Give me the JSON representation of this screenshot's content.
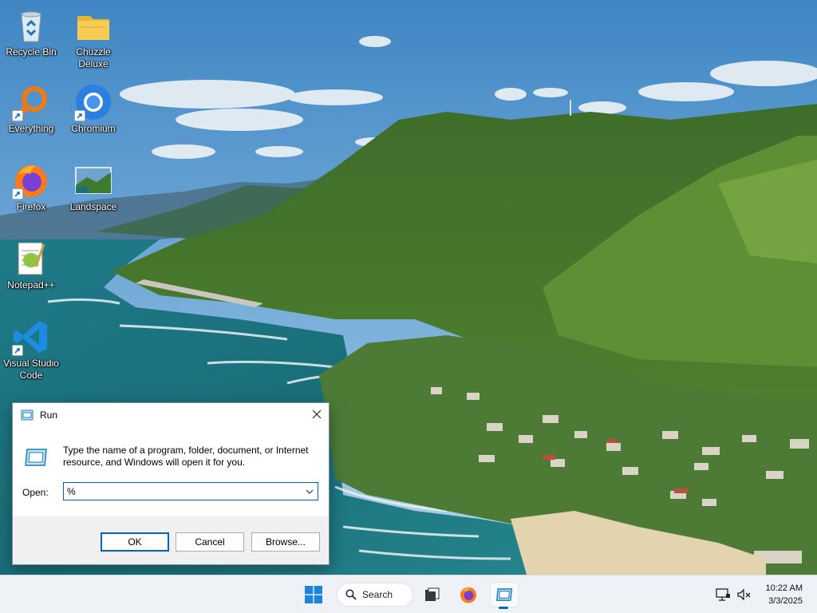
{
  "desktop": {
    "icons": [
      {
        "label": "Recycle Bin",
        "icon": "recycle-bin-icon"
      },
      {
        "label": "Chuzzle Deluxe",
        "icon": "folder-icon"
      },
      {
        "label": "Everything",
        "icon": "everything-search-icon"
      },
      {
        "label": "Chromium",
        "icon": "chromium-icon"
      },
      {
        "label": "Firefox",
        "icon": "firefox-icon"
      },
      {
        "label": "Landspace",
        "icon": "landscape-image-icon"
      },
      {
        "label": "Notepad++",
        "icon": "notepad-plus-plus-icon"
      },
      {
        "label": "Visual Studio Code",
        "icon": "vscode-icon"
      }
    ]
  },
  "run_dialog": {
    "title": "Run",
    "description": "Type the name of a program, folder, document, or Internet resource, and Windows will open it for you.",
    "open_label": "Open:",
    "open_value": "%",
    "ok_label": "OK",
    "cancel_label": "Cancel",
    "browse_label": "Browse..."
  },
  "taskbar": {
    "search_label": "Search",
    "pinned": [
      "start-icon",
      "search-icon",
      "task-view-icon",
      "firefox-icon",
      "run-icon"
    ],
    "active_item": "run-icon",
    "clock_time": "10:22 AM",
    "clock_date": "3/3/2025"
  },
  "colors": {
    "accent": "#0067c0",
    "taskbar_bg": "#eef1f5",
    "dialog_footer": "#f0f0f0"
  }
}
